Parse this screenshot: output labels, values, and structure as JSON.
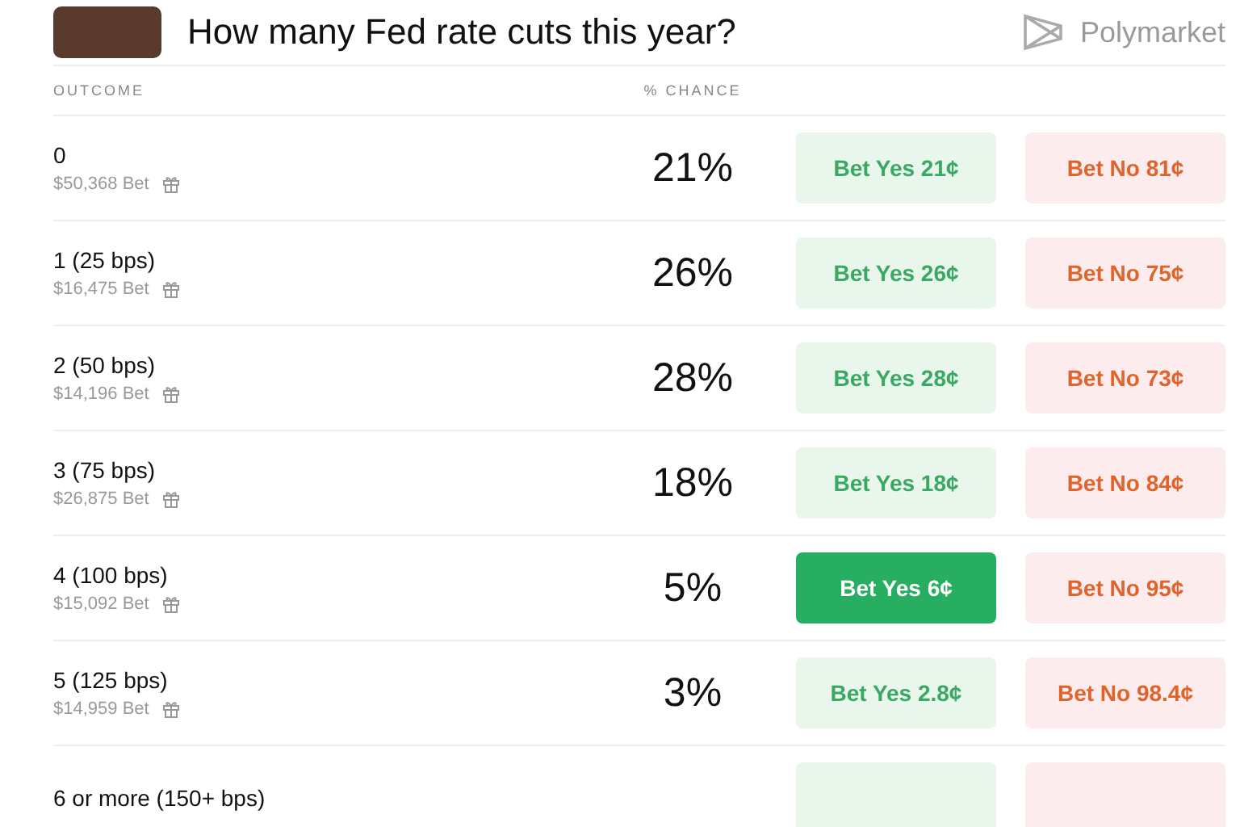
{
  "header": {
    "title": "How many Fed rate cuts this year?",
    "brand": "Polymarket"
  },
  "columns": {
    "outcome": "OUTCOME",
    "chance": "% CHANCE"
  },
  "rows": [
    {
      "outcome": "0",
      "volume": "$50,368 Bet",
      "chance": "21%",
      "yes": "Bet Yes 21¢",
      "no": "Bet No 81¢",
      "selected": false
    },
    {
      "outcome": "1 (25 bps)",
      "volume": "$16,475 Bet",
      "chance": "26%",
      "yes": "Bet Yes 26¢",
      "no": "Bet No 75¢",
      "selected": false
    },
    {
      "outcome": "2 (50 bps)",
      "volume": "$14,196 Bet",
      "chance": "28%",
      "yes": "Bet Yes 28¢",
      "no": "Bet No 73¢",
      "selected": false
    },
    {
      "outcome": "3 (75 bps)",
      "volume": "$26,875 Bet",
      "chance": "18%",
      "yes": "Bet Yes 18¢",
      "no": "Bet No 84¢",
      "selected": false
    },
    {
      "outcome": "4 (100 bps)",
      "volume": "$15,092 Bet",
      "chance": "5%",
      "yes": "Bet Yes 6¢",
      "no": "Bet No 95¢",
      "selected": true
    },
    {
      "outcome": "5 (125 bps)",
      "volume": "$14,959 Bet",
      "chance": "3%",
      "yes": "Bet Yes 2.8¢",
      "no": "Bet No 98.4¢",
      "selected": false
    },
    {
      "outcome": "6 or more (150+ bps)",
      "selected": false
    }
  ]
}
